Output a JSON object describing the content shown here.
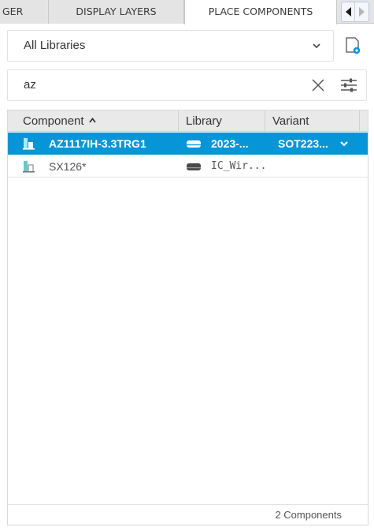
{
  "tabs": [
    {
      "label": "GER"
    },
    {
      "label": "DISPLAY LAYERS"
    },
    {
      "label": "PLACE COMPONENTS"
    }
  ],
  "tab_nav": {
    "prev_icon": "triangle-left-icon",
    "next_icon": "triangle-right-icon"
  },
  "library_select": {
    "value": "All Libraries",
    "icon": "chevron-down-icon"
  },
  "library_settings_icon": "library-settings-icon",
  "search": {
    "value": "az",
    "clear_icon": "close-icon",
    "filter_icon": "sliders-icon"
  },
  "table": {
    "columns": [
      {
        "label": "Component",
        "sorted": "ascending"
      },
      {
        "label": "Library"
      },
      {
        "label": "Variant"
      }
    ],
    "rows": [
      {
        "component": "AZ1117IH-3.3TRG1",
        "library": "2023-...",
        "variant": "SOT223...",
        "selected": true
      },
      {
        "component": "SX126*",
        "library": "IC_Wir...",
        "variant": "",
        "selected": false
      }
    ],
    "footer_count": "2 Components"
  },
  "colors": {
    "accent": "#0696d7",
    "tab_bg": "#e4e4e4",
    "active_tab_bg": "#ffffff",
    "header_bg": "#e9e9e9",
    "part_icon_teal": "#6cc5c9"
  }
}
